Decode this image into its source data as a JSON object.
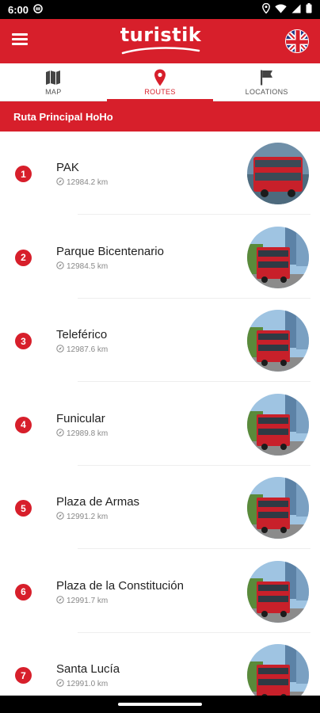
{
  "statusbar": {
    "time": "6:00"
  },
  "appbar": {
    "logo_text": "turistik",
    "language": "en"
  },
  "tabs": [
    {
      "label": "MAP",
      "icon": "map-icon",
      "active": false
    },
    {
      "label": "ROUTES",
      "icon": "location-pin-icon",
      "active": true
    },
    {
      "label": "LOCATIONS",
      "icon": "flag-icon",
      "active": false
    }
  ],
  "route_header": {
    "title": "Ruta Principal HoHo"
  },
  "stops": [
    {
      "number": "1",
      "name": "PAK",
      "distance": "12984.2 km"
    },
    {
      "number": "2",
      "name": "Parque Bicentenario",
      "distance": "12984.5 km"
    },
    {
      "number": "3",
      "name": "Teleférico",
      "distance": "12987.6 km"
    },
    {
      "number": "4",
      "name": "Funicular",
      "distance": "12989.8 km"
    },
    {
      "number": "5",
      "name": "Plaza de Armas",
      "distance": "12991.2 km"
    },
    {
      "number": "6",
      "name": "Plaza de la Constitución",
      "distance": "12991.7 km"
    },
    {
      "number": "7",
      "name": "Santa Lucía",
      "distance": "12991.0 km"
    }
  ],
  "colors": {
    "brand": "#d71f2b",
    "text": "#222222",
    "muted": "#888888"
  }
}
